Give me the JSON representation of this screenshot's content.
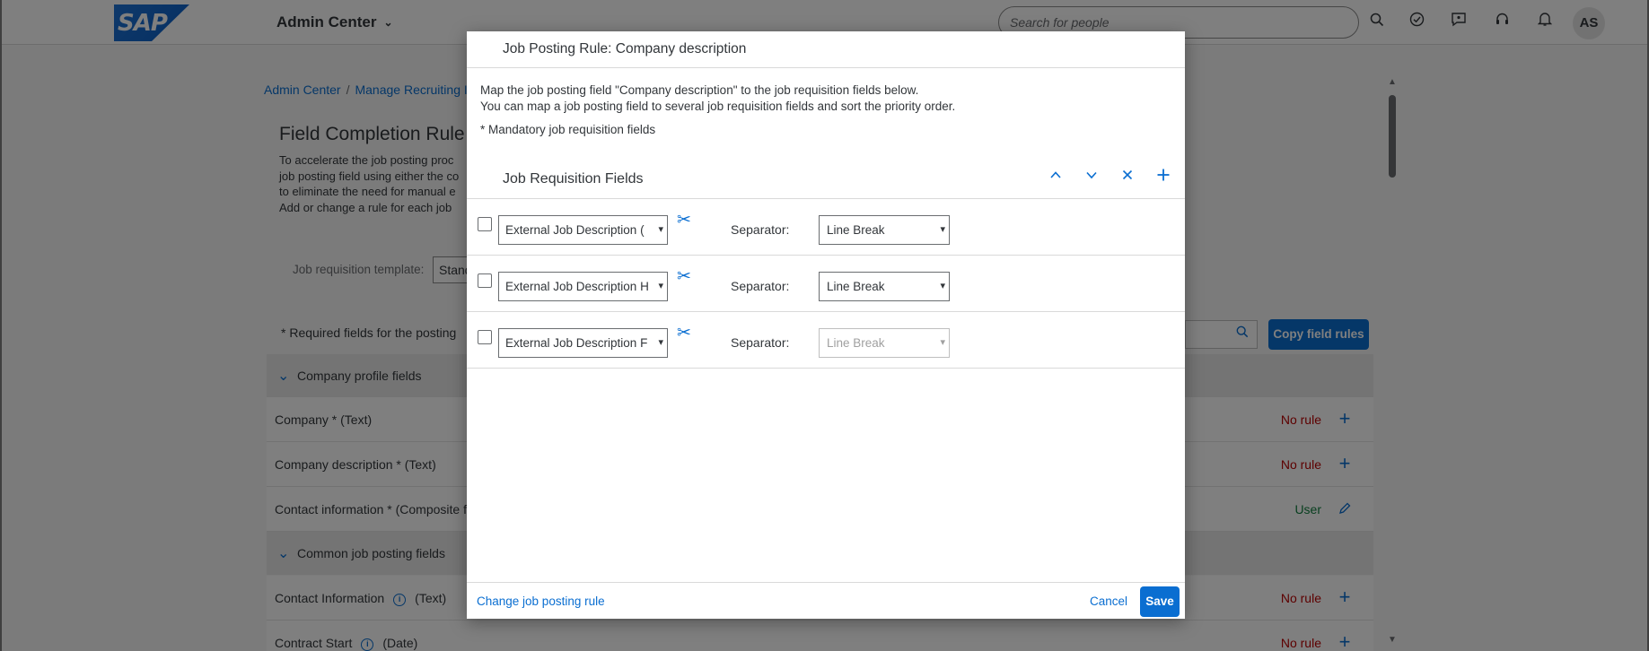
{
  "topbar": {
    "logo_text": "SAP",
    "app_title": "Admin Center",
    "search_placeholder": "Search for people",
    "icons": [
      "search-icon",
      "check-circle-icon",
      "feedback-icon",
      "headset-icon",
      "bell-icon"
    ],
    "avatar_initials": "AS"
  },
  "background": {
    "breadcrumb": [
      "Admin Center",
      "Manage Recruiting I"
    ],
    "page_title": "Field Completion Rule",
    "description_lines": [
      "To accelerate the job posting proc",
      "job posting field using either the co",
      "to eliminate the need for manual e",
      "Add or change a rule for each job"
    ],
    "template_label": "Job requisition template:",
    "template_value": "Stand",
    "required_note": "* Required fields for the posting",
    "copy_button": "Copy field rules",
    "groups": [
      {
        "label": "Company profile fields",
        "fields": [
          {
            "label": "Company * (Text)",
            "status": "No rule",
            "status_type": "norule",
            "action": "add-icon"
          },
          {
            "label": "Company description * (Text)",
            "status": "No rule",
            "status_type": "norule",
            "action": "add-icon"
          },
          {
            "label": "Contact information * (Composite f",
            "status": "User",
            "status_type": "user",
            "action": "edit-icon"
          }
        ]
      },
      {
        "label": "Common job posting fields",
        "fields": [
          {
            "label": "Contact Information",
            "type_suffix": "(Text)",
            "status": "No rule",
            "status_type": "norule",
            "action": "add-icon"
          },
          {
            "label": "Contract Start",
            "type_suffix": "(Date)",
            "status": "No rule",
            "status_type": "norule",
            "action": "add-icon"
          }
        ]
      }
    ]
  },
  "dialog": {
    "title": "Job Posting Rule: Company description",
    "intro_line1": "Map the job posting field \"Company description\" to the job requisition fields below.",
    "intro_line2": "You can map a job posting field to several job requisition fields and sort the priority order.",
    "mandatory_note": "* Mandatory job requisition fields",
    "section_title": "Job Requisition Fields",
    "tools": [
      "move-up-icon",
      "move-down-icon",
      "remove-icon",
      "add-icon"
    ],
    "separator_label": "Separator:",
    "rows": [
      {
        "field": "External Job Description (",
        "separator": "Line Break",
        "separator_disabled": false
      },
      {
        "field": "External Job Description H",
        "separator": "Line Break",
        "separator_disabled": false
      },
      {
        "field": "External Job Description F",
        "separator": "Line Break",
        "separator_disabled": true
      }
    ],
    "footer": {
      "change_link": "Change job posting rule",
      "cancel": "Cancel",
      "save": "Save"
    }
  }
}
